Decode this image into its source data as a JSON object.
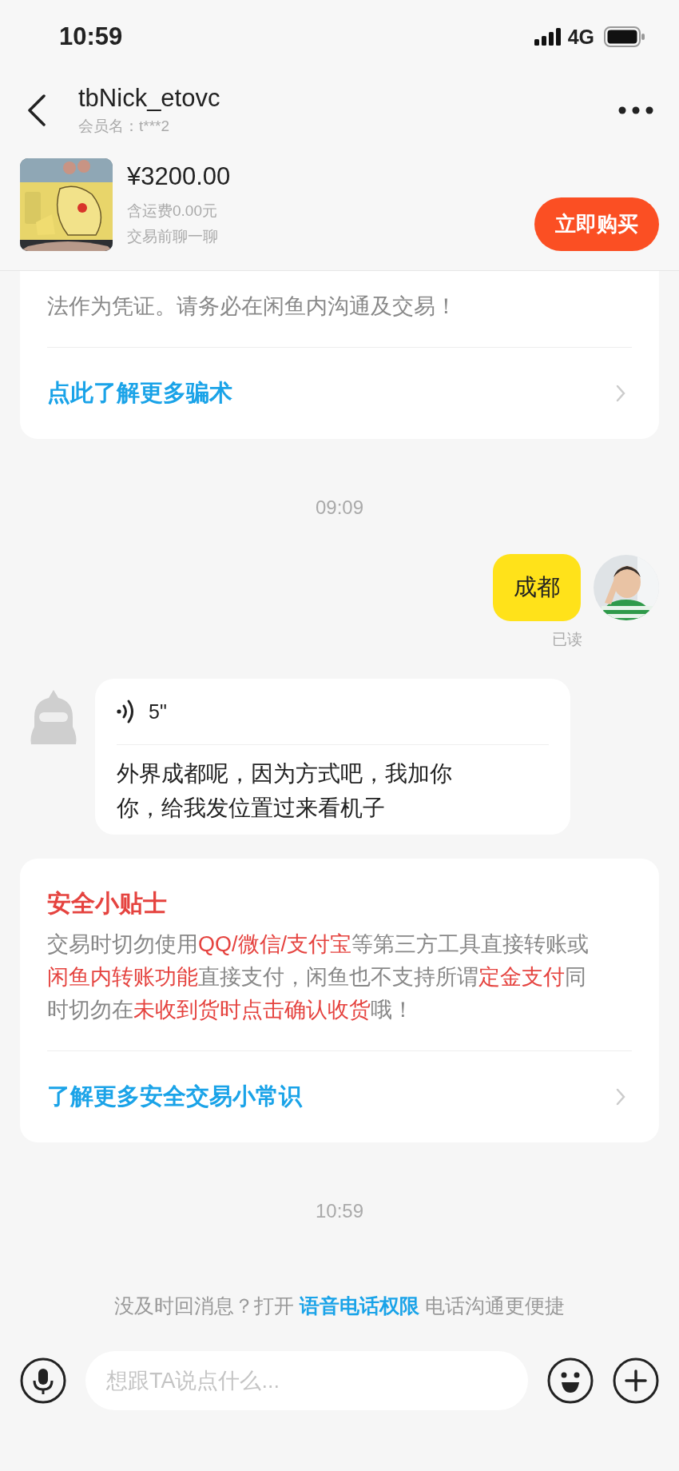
{
  "status_bar": {
    "time": "10:59",
    "network": "4G"
  },
  "header": {
    "title": "tbNick_etovc",
    "subtitle": "会员名：t***2"
  },
  "product": {
    "price": "¥3200.00",
    "shipping": "含运费0.00元",
    "note": "交易前聊一聊",
    "buy_button": "立即购买"
  },
  "messages": [
    {
      "kind": "notice_card",
      "lines": [
        [
          {
            "text": "法作为凭证。请务必在闲鱼内沟通及交易！",
            "highlight": false
          }
        ]
      ],
      "link": "点此了解更多骗术"
    },
    {
      "kind": "time",
      "text": "09:09"
    },
    {
      "kind": "outgoing",
      "text": "成都",
      "status": "已读"
    },
    {
      "kind": "incoming_voice",
      "duration": "5\"",
      "lines": [
        "外界成都呢，因为方式吧，我加你",
        "你，给我发位置过来看机子"
      ]
    },
    {
      "kind": "notice_card",
      "title": "安全小贴士",
      "lines": [
        [
          {
            "text": "交易时切勿使用",
            "highlight": false
          },
          {
            "text": "QQ/微信/支付宝",
            "highlight": true
          },
          {
            "text": "等第三方工具直接转账或",
            "highlight": false
          }
        ],
        [
          {
            "text": "闲鱼内转账功能",
            "highlight": true
          },
          {
            "text": "直接支付，闲鱼也不支持所谓",
            "highlight": false
          },
          {
            "text": "定金支付",
            "highlight": true
          },
          {
            "text": "同",
            "highlight": false
          }
        ],
        [
          {
            "text": "时切勿在",
            "highlight": false
          },
          {
            "text": "未收到货时点击确认收货",
            "highlight": true
          },
          {
            "text": "哦！",
            "highlight": false
          }
        ]
      ],
      "link": "了解更多安全交易小常识"
    },
    {
      "kind": "time",
      "text": "10:59"
    },
    {
      "kind": "hint",
      "before": "没及时回消息？打开",
      "link": "语音电话权限",
      "after": "电话沟通更便捷"
    }
  ],
  "composer": {
    "placeholder": "想跟TA说点什么..."
  }
}
